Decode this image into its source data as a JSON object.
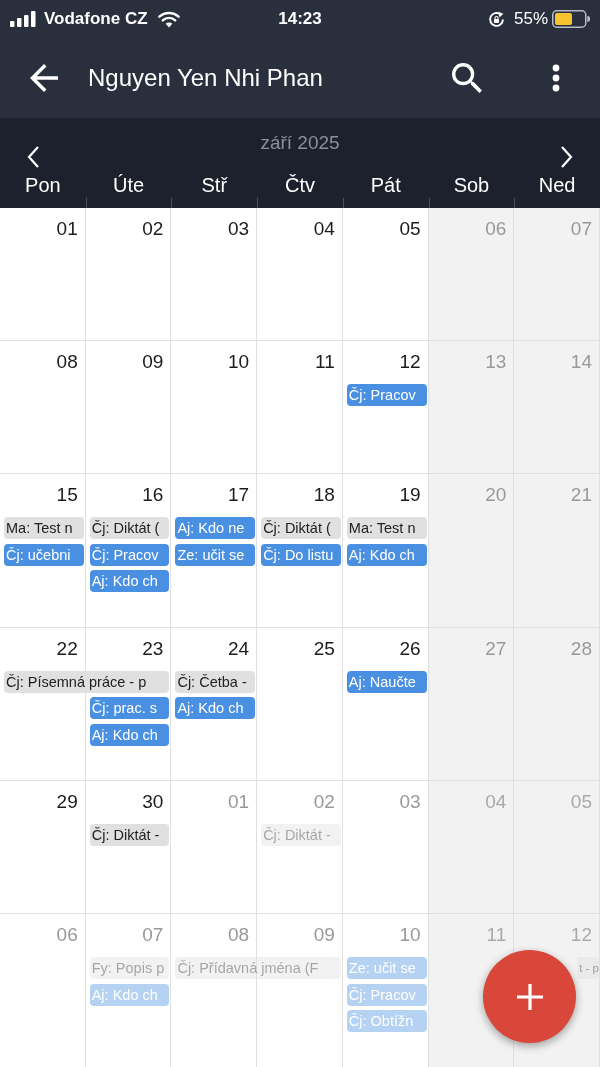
{
  "status_bar": {
    "carrier": "Vodafone CZ",
    "time": "14:23",
    "battery_percent": "55%"
  },
  "app_bar": {
    "title": "Nguyen Yen Nhi Phan"
  },
  "calendar": {
    "month": "září 2025",
    "weekdays": [
      {
        "label": "Pon",
        "weekend": false
      },
      {
        "label": "Úte",
        "weekend": false
      },
      {
        "label": "Stř",
        "weekend": false
      },
      {
        "label": "Čtv",
        "weekend": false
      },
      {
        "label": "Pát",
        "weekend": false
      },
      {
        "label": "Sob",
        "weekend": true
      },
      {
        "label": "Ned",
        "weekend": true
      }
    ],
    "weeks": [
      {
        "days": [
          {
            "date": "01",
            "outside_month": false
          },
          {
            "date": "02",
            "outside_month": false
          },
          {
            "date": "03",
            "outside_month": false
          },
          {
            "date": "04",
            "outside_month": false
          },
          {
            "date": "05",
            "outside_month": false
          },
          {
            "date": "06",
            "outside_month": false
          },
          {
            "date": "07",
            "outside_month": false
          }
        ]
      },
      {
        "days": [
          {
            "date": "08",
            "outside_month": false
          },
          {
            "date": "09",
            "outside_month": false
          },
          {
            "date": "10",
            "outside_month": false
          },
          {
            "date": "11",
            "outside_month": false
          },
          {
            "date": "12",
            "outside_month": false,
            "events": [
              {
                "title": "Čj: Pracov",
                "kind": "homework"
              }
            ]
          },
          {
            "date": "13",
            "outside_month": false
          },
          {
            "date": "14",
            "outside_month": false
          }
        ]
      },
      {
        "days": [
          {
            "date": "15",
            "outside_month": false,
            "events": [
              {
                "title": "Ma: Test n",
                "kind": "test"
              },
              {
                "title": "Čj: učebni",
                "kind": "homework"
              }
            ]
          },
          {
            "date": "16",
            "outside_month": false,
            "events": [
              {
                "title": "Čj: Diktát (",
                "kind": "test"
              },
              {
                "title": "Čj: Pracov",
                "kind": "homework"
              },
              {
                "title": "Aj: Kdo ch",
                "kind": "homework"
              }
            ]
          },
          {
            "date": "17",
            "outside_month": false,
            "events": [
              {
                "title": "Aj: Kdo ne",
                "kind": "homework"
              },
              {
                "title": "Ze: učit se",
                "kind": "homework"
              }
            ]
          },
          {
            "date": "18",
            "outside_month": false,
            "events": [
              {
                "title": "Čj: Diktát (",
                "kind": "test"
              },
              {
                "title": "Čj: Do listu",
                "kind": "homework"
              }
            ]
          },
          {
            "date": "19",
            "outside_month": false,
            "events": [
              {
                "title": "Ma: Test n",
                "kind": "test"
              },
              {
                "title": "Aj: Kdo ch",
                "kind": "homework"
              }
            ]
          },
          {
            "date": "20",
            "outside_month": false
          },
          {
            "date": "21",
            "outside_month": false
          }
        ]
      },
      {
        "days": [
          {
            "date": "22",
            "outside_month": false,
            "events": [
              {
                "title": "Čj: Písemná práce - p",
                "kind": "test",
                "spans_next_day": true
              }
            ]
          },
          {
            "date": "23",
            "outside_month": false,
            "events": [
              {
                "title": "Čj: prac. s",
                "kind": "homework"
              },
              {
                "title": "Aj: Kdo ch",
                "kind": "homework"
              }
            ]
          },
          {
            "date": "24",
            "outside_month": false,
            "events": [
              {
                "title": "Čj: Četba -",
                "kind": "test"
              },
              {
                "title": "Aj: Kdo ch",
                "kind": "homework"
              }
            ]
          },
          {
            "date": "25",
            "outside_month": false
          },
          {
            "date": "26",
            "outside_month": false,
            "events": [
              {
                "title": "Aj: Naučte",
                "kind": "homework"
              }
            ]
          },
          {
            "date": "27",
            "outside_month": false
          },
          {
            "date": "28",
            "outside_month": false
          }
        ]
      },
      {
        "days": [
          {
            "date": "29",
            "outside_month": false
          },
          {
            "date": "30",
            "outside_month": false,
            "events": [
              {
                "title": "Čj: Diktát -",
                "kind": "test"
              }
            ]
          },
          {
            "date": "01",
            "outside_month": true
          },
          {
            "date": "02",
            "outside_month": true,
            "events": [
              {
                "title": "Čj: Diktát -",
                "kind": "test"
              }
            ]
          },
          {
            "date": "03",
            "outside_month": true
          },
          {
            "date": "04",
            "outside_month": true
          },
          {
            "date": "05",
            "outside_month": true
          }
        ]
      },
      {
        "days": [
          {
            "date": "06",
            "outside_month": true
          },
          {
            "date": "07",
            "outside_month": true,
            "events": [
              {
                "title": "Fy: Popis p",
                "kind": "test"
              },
              {
                "title": "Aj: Kdo ch",
                "kind": "homework"
              }
            ]
          },
          {
            "date": "08",
            "outside_month": true,
            "events": [
              {
                "title": "Čj: Přídavná jména (F",
                "kind": "test",
                "spans_next_day": true
              }
            ]
          },
          {
            "date": "09",
            "outside_month": true
          },
          {
            "date": "10",
            "outside_month": true,
            "events": [
              {
                "title": "Ze: učit se",
                "kind": "homework"
              },
              {
                "title": "Čj: Pracov",
                "kind": "homework"
              },
              {
                "title": "Čj: Obtížn",
                "kind": "homework"
              }
            ]
          },
          {
            "date": "11",
            "outside_month": true
          },
          {
            "date": "12",
            "outside_month": true,
            "events": [
              {
                "title": "t - p",
                "kind": "test",
                "clipped_start": true
              }
            ]
          }
        ]
      }
    ]
  }
}
